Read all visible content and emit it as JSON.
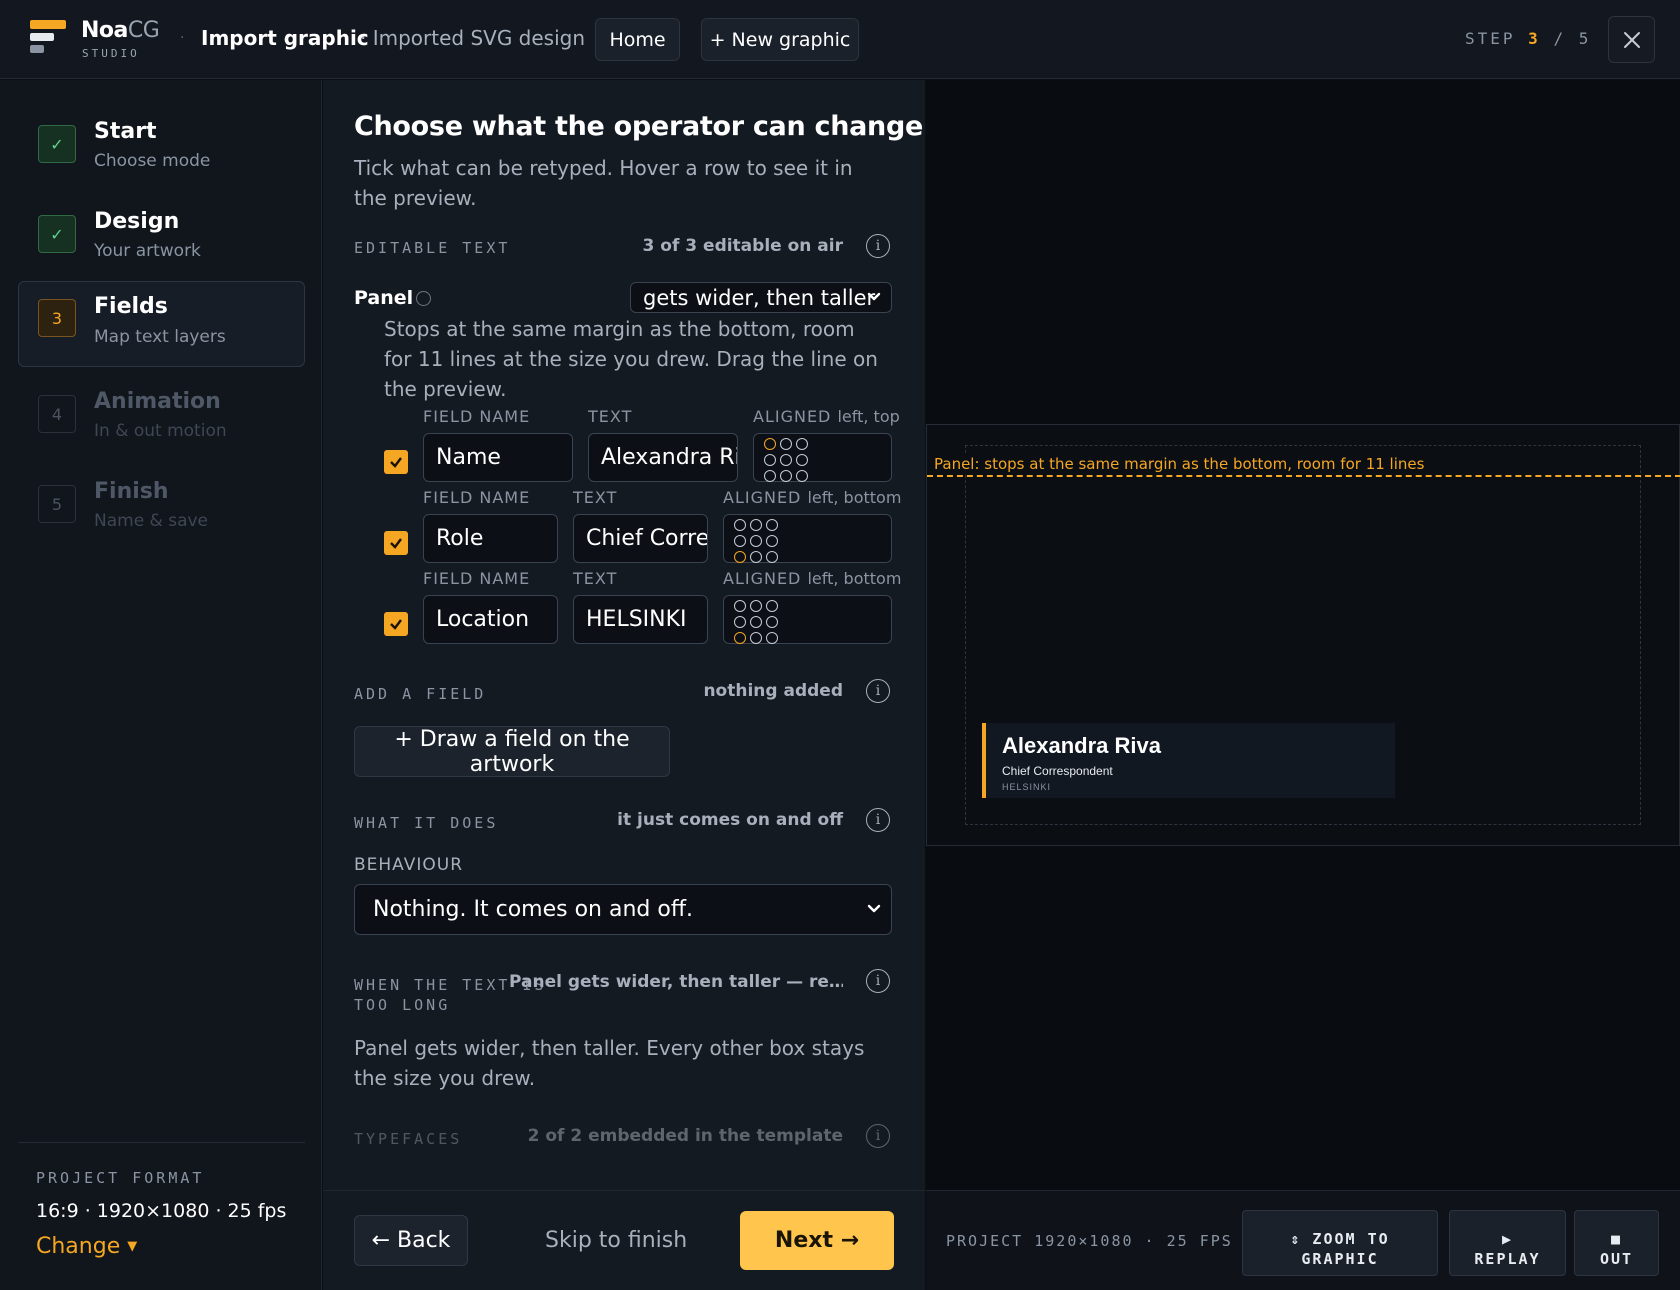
{
  "header": {
    "brand_main": "Noa",
    "brand_accent": "CG",
    "brand_sub": "STUDIO",
    "separator": "·",
    "title": "Import graphic",
    "subtitle": "· Imported SVG design",
    "home_label": "Home",
    "new_graphic_label": "+ New graphic",
    "step_prefix": "STEP",
    "step_current": "3",
    "step_separator": "/",
    "step_total": "5",
    "close_icon": "close-icon"
  },
  "sidebar": {
    "steps": [
      {
        "badge": "✓",
        "label": "Start",
        "sub": "Choose mode",
        "state": "done"
      },
      {
        "badge": "✓",
        "label": "Design",
        "sub": "Your artwork",
        "state": "done"
      },
      {
        "badge": "3",
        "label": "Fields",
        "sub": "Map text layers",
        "state": "active"
      },
      {
        "badge": "4",
        "label": "Animation",
        "sub": "In & out motion",
        "state": "todo"
      },
      {
        "badge": "5",
        "label": "Finish",
        "sub": "Name & save",
        "state": "todo"
      }
    ],
    "project_format_label": "PROJECT FORMAT",
    "project_format_value": "16:9 · 1920×1080 · 25 fps",
    "change_label": "Change"
  },
  "main": {
    "title": "Choose what the operator can change",
    "description": "Tick what can be retyped. Hover a row to see it in the preview.",
    "editable_text": {
      "label": "EDITABLE TEXT",
      "value": "3 of 3 editable on air",
      "panel_label": "Panel",
      "grow_option": "gets wider, then taller",
      "panel_note": "Stops at the same margin as the bottom, room for 11 lines at the size you drew. Drag the line on the preview.",
      "field_name_header": "FIELD NAME",
      "text_header": "TEXT",
      "aligned_header": "ALIGNED",
      "fields": [
        {
          "checked": true,
          "name": "Name",
          "text": "Alexandra Riva",
          "align": "left, top",
          "dot": 0
        },
        {
          "checked": true,
          "name": "Role",
          "text": "Chief Correspondent",
          "align": "left, bottom",
          "dot": 6
        },
        {
          "checked": true,
          "name": "Location",
          "text": "HELSINKI",
          "align": "left, bottom",
          "dot": 6
        }
      ]
    },
    "add_field": {
      "label": "ADD A FIELD",
      "value": "nothing added",
      "button": "+  Draw a field on the artwork"
    },
    "what_it_does": {
      "label": "WHAT IT DOES",
      "value": "it just comes on and off",
      "behaviour_label": "BEHAVIOUR",
      "behaviour_value": "Nothing. It comes on and off."
    },
    "overflow": {
      "label_line1": "WHEN THE TEXT IS",
      "label_line2": "TOO LONG",
      "value": "Panel gets wider, then taller — re…",
      "description": "Panel gets wider, then taller. Every other box stays the size you drew."
    },
    "typefaces": {
      "label": "TYPEFACES",
      "value": "2 of 2 embedded in the template"
    },
    "info_glyph": "i"
  },
  "footer": {
    "back_label": "← Back",
    "skip_label": "Skip to finish",
    "next_label": "Next →"
  },
  "preview": {
    "guide_label": "Panel: stops at the same margin as the bottom, room for 11 lines",
    "lt_name": "Alexandra Riva",
    "lt_role": "Chief Correspondent",
    "lt_location": "HELSINKI",
    "project_info": "PROJECT 1920×1080 · 25 FPS",
    "zoom_line1": "⇕ ZOOM TO",
    "zoom_line2": "GRAPHIC",
    "replay_icon": "▶",
    "replay_label": "REPLAY",
    "out_icon": "■",
    "out_label": "OUT"
  },
  "colors": {
    "accent": "#f5a623",
    "next_button": "#ffc54d",
    "done_green": "#5ed38a"
  }
}
